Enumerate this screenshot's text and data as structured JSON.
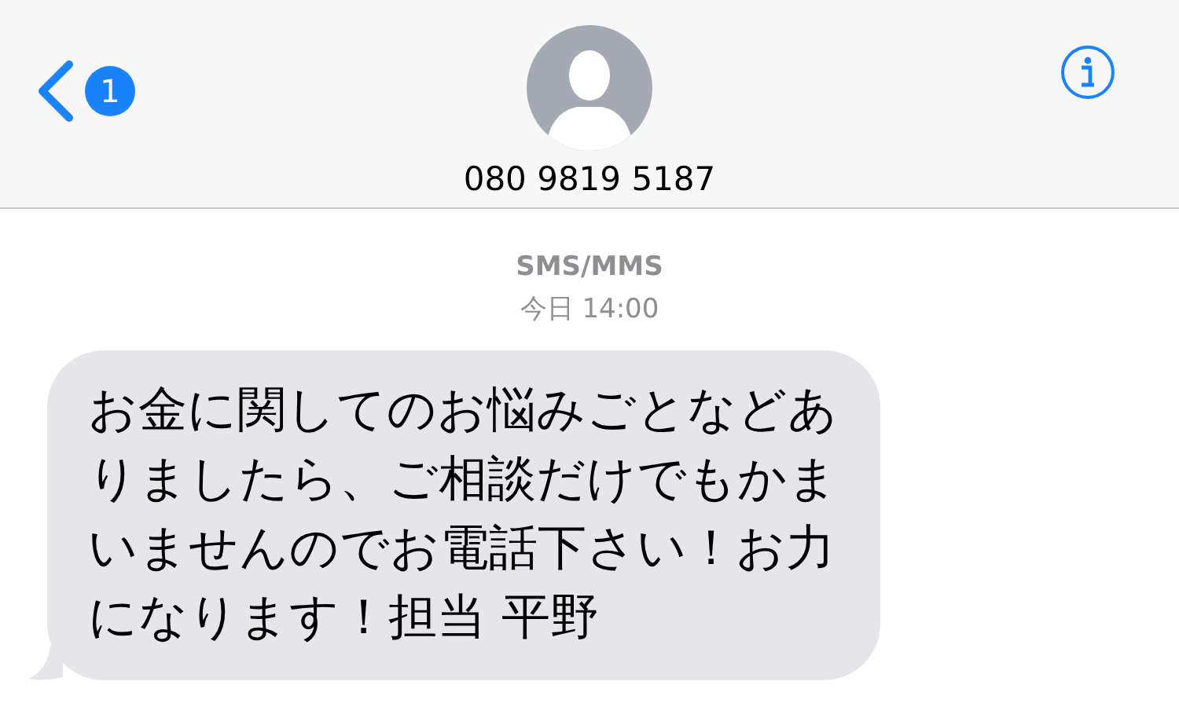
{
  "header": {
    "unread_count": "1",
    "contact": "080 9819 5187"
  },
  "thread": {
    "service": "SMS/MMS",
    "timestamp": "今日 14:00",
    "messages": [
      {
        "text": "お金に関してのお悩みごとなどありましたら、ご相談だけでもかまいませんのでお電話下さい！お力になります！担当 平野",
        "incoming": true
      }
    ]
  }
}
